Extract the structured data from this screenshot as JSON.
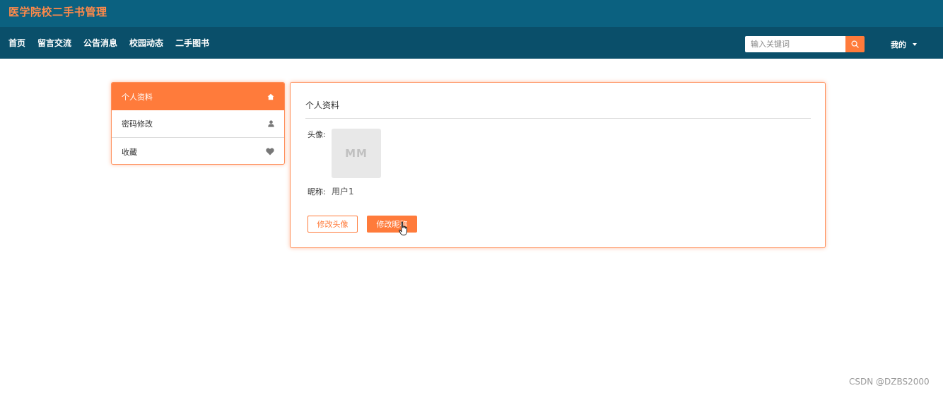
{
  "header": {
    "site_title": "医学院校二手书管理"
  },
  "nav": {
    "items": [
      "首页",
      "留言交流",
      "公告消息",
      "校园动态",
      "二手图书"
    ],
    "search_placeholder": "输入关键词",
    "user_menu_label": "我的"
  },
  "sidebar": {
    "items": [
      {
        "label": "个人资料",
        "icon": "home-icon",
        "active": true
      },
      {
        "label": "密码修改",
        "icon": "user-icon",
        "active": false
      },
      {
        "label": "收藏",
        "icon": "heart-icon",
        "active": false
      }
    ]
  },
  "profile": {
    "title": "个人资料",
    "avatar_label": "头像:",
    "avatar_placeholder": "MM",
    "nickname_label": "昵称:",
    "nickname_value": "用户1",
    "change_avatar_button": "修改头像",
    "change_nickname_button": "修改昵称"
  },
  "watermark": "CSDN @DZBS2000",
  "colors": {
    "topbar": "#0b6180",
    "navbar": "#0a4f6a",
    "accent": "#ff7b3b"
  }
}
